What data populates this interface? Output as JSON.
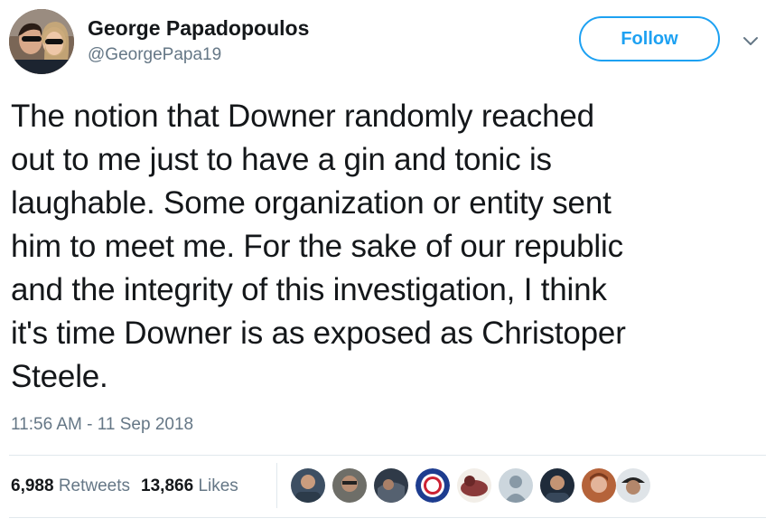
{
  "tweet": {
    "author_name": "George Papadopoulos",
    "author_handle": "@GeorgePapa19",
    "follow_label": "Follow",
    "text_lines": [
      "The notion that Downer randomly reached",
      "out to me just to have a gin and tonic is",
      "laughable. Some organization or entity sent",
      "him to meet me. For the sake of our republic",
      "and the integrity of this investigation, I think",
      "it's time Downer is as exposed as Christoper",
      "Steele."
    ],
    "timestamp": "11:56 AM - 11 Sep 2018",
    "retweets_count": "6,988",
    "retweets_label": "Retweets",
    "likes_count": "13,866",
    "likes_label": "Likes"
  },
  "icons": {
    "caret": "chevron-down-icon",
    "avatar": "profile-photo"
  },
  "colors": {
    "accent": "#1da1f2",
    "secondary_text": "#657786",
    "primary_text": "#14171a",
    "divider": "#e1e8ed"
  }
}
